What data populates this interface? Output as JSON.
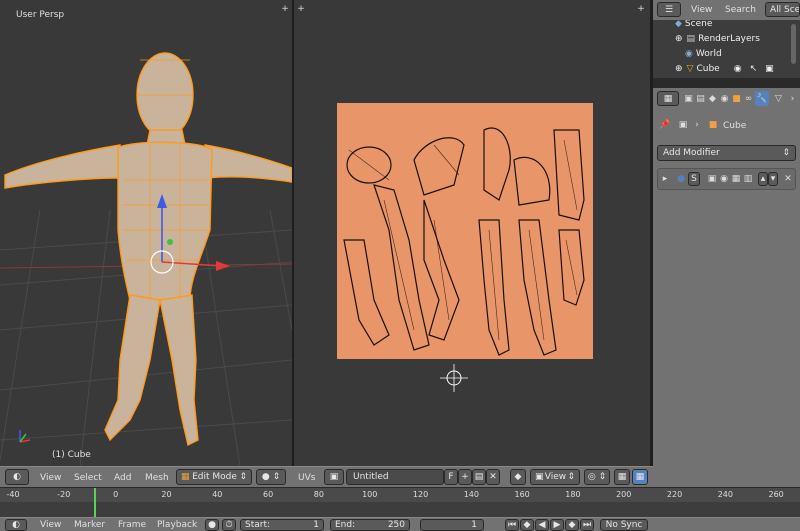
{
  "viewport": {
    "title": "User Persp",
    "object_label": "(1) Cube",
    "menu": [
      "View",
      "Select",
      "Add",
      "Mesh"
    ],
    "mode": "Edit Mode"
  },
  "uv_editor": {
    "menu_label": "UVs",
    "image_name": "Untitled",
    "fake_user": "F",
    "view_label": "View",
    "texture_color": "#e8956a"
  },
  "outliner": {
    "menu": [
      "View",
      "Search",
      "All Scenes"
    ],
    "items": [
      "Scene",
      "RenderLayers",
      "World",
      "Cube"
    ]
  },
  "properties": {
    "object_name": "Cube",
    "add_modifier": "Add Modifier",
    "modifier_s": "S"
  },
  "timeline": {
    "ticks": [
      "-40",
      "-20",
      "0",
      "20",
      "40",
      "60",
      "80",
      "100",
      "120",
      "140",
      "160",
      "180",
      "200",
      "220",
      "240",
      "260"
    ],
    "current_frame": 0,
    "menu": [
      "View",
      "Marker",
      "Frame",
      "Playback"
    ],
    "start_label": "Start:",
    "start_value": "1",
    "end_label": "End:",
    "end_value": "250",
    "current_value": "1",
    "sync": "No Sync"
  },
  "colors": {
    "wire": "#ff9a1a",
    "accent": "#5680c2"
  }
}
